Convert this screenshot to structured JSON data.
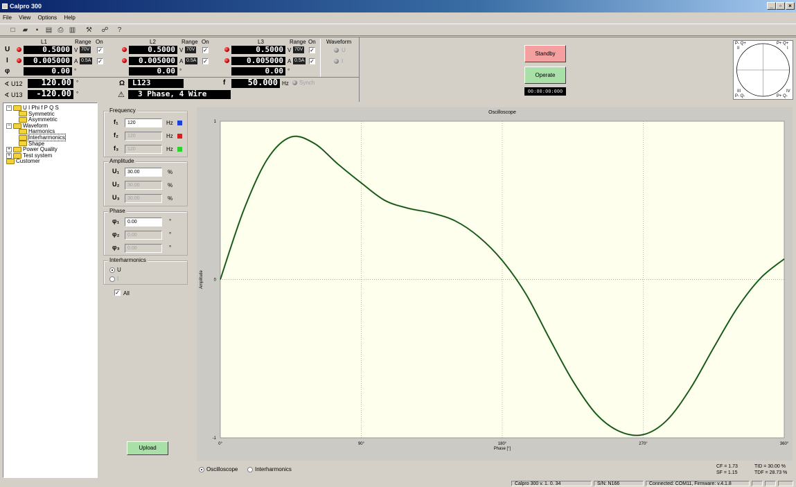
{
  "window": {
    "title": "Calpro 300"
  },
  "menu": [
    "File",
    "View",
    "Options",
    "Help"
  ],
  "toolbar": {
    "icons": [
      "new-icon",
      "open-icon",
      "save-icon",
      "page-icon",
      "print-icon",
      "preview-icon",
      "settings-icon",
      "connect-icon",
      "help-icon"
    ]
  },
  "phases": {
    "l1": {
      "name": "L1",
      "range": "Range",
      "on": "On",
      "u": "0.5000",
      "u_unit": "V",
      "u_range": "70V",
      "i": "0.005000",
      "i_unit": "A",
      "i_range": "0.5A",
      "phi": "0.00",
      "phi_unit": "°"
    },
    "l2": {
      "name": "L2",
      "range": "Range",
      "on": "On",
      "u": "0.5000",
      "u_unit": "V",
      "u_range": "70V",
      "i": "0.005000",
      "i_unit": "A",
      "i_range": "0.5A",
      "phi": "0.00",
      "phi_unit": "°"
    },
    "l3": {
      "name": "L3",
      "range": "Range",
      "on": "On",
      "u": "0.5000",
      "u_unit": "V",
      "u_range": "70V",
      "i": "0.005000",
      "i_unit": "A",
      "i_range": "0.5A",
      "phi": "0.00",
      "phi_unit": "°"
    }
  },
  "row_labels": {
    "u": "U",
    "i": "I",
    "phi": "φ"
  },
  "waveform_box": {
    "title": "Waveform",
    "u": "U",
    "i": "I"
  },
  "angles": {
    "u12_label": "∢ U12",
    "u12": "120.00",
    "u13_label": "∢ U13",
    "u13": "-120.00",
    "deg": "°"
  },
  "system": {
    "omega": "Ω",
    "phase_seq": "L123",
    "warn": "⚠",
    "wiring": "3 Phase, 4 Wire",
    "f_label": "f",
    "freq": "50.000",
    "hz": "Hz",
    "synch": "Synch"
  },
  "controls": {
    "standby": "Standby",
    "operate": "Operate",
    "timer": "00:00:00:000"
  },
  "phasor": {
    "tl": "P- Q+",
    "tl2": "II",
    "tr": "P+ Q+",
    "tr2": "I",
    "bl": "III",
    "bl2": "P- Q-",
    "br": "IV",
    "br2": "P+ Q-"
  },
  "tree": [
    {
      "label": "U I Phi f P Q S",
      "level": 0,
      "expander": "−"
    },
    {
      "label": "Symmetric",
      "level": 1
    },
    {
      "label": "Asymmetric",
      "level": 1
    },
    {
      "label": "Waveform",
      "level": 0,
      "expander": "−"
    },
    {
      "label": "Harmonics",
      "level": 1
    },
    {
      "label": "Interharmonics",
      "level": 1,
      "selected": true
    },
    {
      "label": "Shape",
      "level": 1
    },
    {
      "label": "Power Quality",
      "level": 0,
      "expander": "+"
    },
    {
      "label": "Test system",
      "level": 0,
      "expander": "+"
    },
    {
      "label": "Customer",
      "level": 0
    }
  ],
  "params": {
    "frequency": {
      "title": "Frequency",
      "f1_label": "f₁",
      "f1": "120",
      "f2_label": "f₂",
      "f2": "120",
      "f3_label": "f₃",
      "f3": "120",
      "unit": "Hz"
    },
    "amplitude": {
      "title": "Amplitude",
      "u1_label": "U₁",
      "u1": "30.00",
      "u2_label": "U₂",
      "u2": "30.00",
      "u3_label": "U₃",
      "u3": "30.00",
      "unit": "%"
    },
    "phase": {
      "title": "Phase",
      "p1_label": "φ₁",
      "p1": "0.00",
      "p2_label": "φ₂",
      "p2": "0.00",
      "p3_label": "φ₃",
      "p3": "0.00",
      "unit": "°"
    },
    "interharmonics": {
      "title": "Interharmonics",
      "u": "U",
      "i": "I"
    },
    "all": "All",
    "upload": "Upload",
    "colors": {
      "f1": "#1f3fd6",
      "f2": "#d62020",
      "f3": "#30d030"
    }
  },
  "chart_data": {
    "type": "line",
    "title": "Oscilloscope",
    "xlabel": "Phase [°]",
    "ylabel": "Amplitude",
    "xlim": [
      0,
      360
    ],
    "ylim": [
      -1,
      1
    ],
    "x_ticks": [
      "0°",
      "90°",
      "180°",
      "270°",
      "360°"
    ],
    "y_ticks": [
      "1",
      "0",
      "-1"
    ],
    "grid": true,
    "series": [
      {
        "x": [
          0,
          15,
          30,
          45,
          60,
          75,
          90,
          105,
          120,
          135,
          150,
          165,
          180,
          195,
          210,
          225,
          240,
          255,
          270,
          285,
          300,
          315,
          330,
          345,
          360
        ],
        "values": [
          0.0,
          0.44,
          0.76,
          0.9,
          0.86,
          0.73,
          0.61,
          0.5,
          0.45,
          0.42,
          0.37,
          0.27,
          0.12,
          -0.09,
          -0.37,
          -0.64,
          -0.85,
          -0.96,
          -0.98,
          -0.89,
          -0.69,
          -0.43,
          -0.18,
          0.01,
          0.13
        ]
      }
    ]
  },
  "view": {
    "oscilloscope": "Oscilloscope",
    "interharmonics": "Interharmonics"
  },
  "metrics": {
    "cf": "CF = 1.73",
    "sf": "SF = 1.15",
    "tid": "TID = 30.00 %",
    "tdf": "TDF = 28.73 %"
  },
  "status": {
    "version": "Calpro 300 v. 1. 0. 34",
    "sn": "S/N: N166",
    "conn": "Connected: COM11,  Firmware: v.4.1.8"
  }
}
